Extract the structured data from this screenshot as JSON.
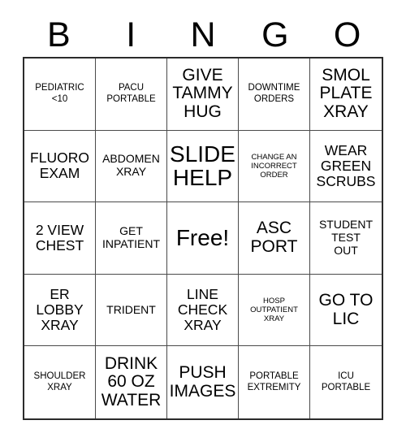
{
  "card": {
    "title": "BINGO",
    "header_letters": [
      "B",
      "I",
      "N",
      "G",
      "O"
    ],
    "grid_size": "5x5",
    "free_space_label": "Free!",
    "colors": {
      "text": "#000000",
      "background": "#ffffff",
      "outer_border": "#2b2b2b",
      "cell_border": "#4a4a4a"
    },
    "cells": [
      {
        "text": "PEDIATRIC\n<10",
        "size": "sm",
        "column": "B"
      },
      {
        "text": "PACU\nPORTABLE",
        "size": "sm",
        "column": "I"
      },
      {
        "text": "GIVE\nTAMMY\nHUG",
        "size": "xl",
        "column": "N"
      },
      {
        "text": "DOWNTIME\nORDERS",
        "size": "sm",
        "column": "G"
      },
      {
        "text": "SMOL\nPLATE\nXRAY",
        "size": "xl",
        "column": "O"
      },
      {
        "text": "FLUORO\nEXAM",
        "size": "lg",
        "column": "B"
      },
      {
        "text": "ABDOMEN\nXRAY",
        "size": "md",
        "column": "I"
      },
      {
        "text": "SLIDE\nHELP",
        "size": "xxl",
        "column": "N"
      },
      {
        "text": "CHANGE AN\nINCORRECT\nORDER",
        "size": "xs",
        "column": "G"
      },
      {
        "text": "WEAR\nGREEN\nSCRUBS",
        "size": "lg",
        "column": "O"
      },
      {
        "text": "2 VIEW\nCHEST",
        "size": "lg",
        "column": "B"
      },
      {
        "text": "GET\nINPATIENT",
        "size": "md",
        "column": "I"
      },
      {
        "text": "Free!",
        "size": "xxl",
        "column": "N"
      },
      {
        "text": "ASC\nPORT",
        "size": "xl",
        "column": "G"
      },
      {
        "text": "STUDENT\nTEST\nOUT",
        "size": "md",
        "column": "O"
      },
      {
        "text": "ER\nLOBBY\nXRAY",
        "size": "lg",
        "column": "B"
      },
      {
        "text": "TRIDENT",
        "size": "md",
        "column": "I"
      },
      {
        "text": "LINE\nCHECK\nXRAY",
        "size": "lg",
        "column": "N"
      },
      {
        "text": "HOSP\nOUTPATIENT\nXRAY",
        "size": "xs",
        "column": "G"
      },
      {
        "text": "GO TO\nLIC",
        "size": "xl",
        "column": "O"
      },
      {
        "text": "SHOULDER\nXRAY",
        "size": "sm",
        "column": "B"
      },
      {
        "text": "DRINK\n60 OZ\nWATER",
        "size": "xl",
        "column": "I"
      },
      {
        "text": "PUSH\nIMAGES",
        "size": "xl",
        "column": "N"
      },
      {
        "text": "PORTABLE\nEXTREMITY",
        "size": "sm",
        "column": "G"
      },
      {
        "text": "ICU\nPORTABLE",
        "size": "sm",
        "column": "O"
      }
    ]
  }
}
